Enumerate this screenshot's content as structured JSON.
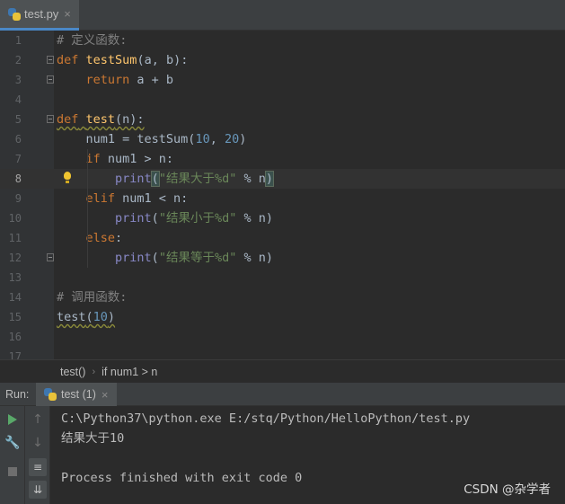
{
  "editor_tab": {
    "filename": "test.py",
    "close": "×"
  },
  "lines": [
    {
      "n": "1"
    },
    {
      "n": "2"
    },
    {
      "n": "3"
    },
    {
      "n": "4"
    },
    {
      "n": "5"
    },
    {
      "n": "6"
    },
    {
      "n": "7"
    },
    {
      "n": "8"
    },
    {
      "n": "9"
    },
    {
      "n": "10"
    },
    {
      "n": "11"
    },
    {
      "n": "12"
    },
    {
      "n": "13"
    },
    {
      "n": "14"
    },
    {
      "n": "15"
    },
    {
      "n": "16"
    },
    {
      "n": "17"
    }
  ],
  "code": {
    "l1_comment": "# 定义函数:",
    "l2_def": "def",
    "l2_name": "testSum",
    "l2_params": "(a, b):",
    "l3_return": "return",
    "l3_expr": " a + b",
    "l5_def": "def",
    "l5_name": "test",
    "l5_params": "(n):",
    "l6_a": "num1 = testSum(",
    "l6_n1": "10",
    "l6_comma": ", ",
    "l6_n2": "20",
    "l6_close": ")",
    "l7_if": "if",
    "l7_cond": " num1 > n:",
    "l8_print": "print",
    "l8_open": "(",
    "l8_str": "\"结果大于%d\"",
    "l8_rest": " % n",
    "l8_close": ")",
    "l9_elif": "elif",
    "l9_cond": " num1 < n:",
    "l10_print": "print",
    "l10_open": "(",
    "l10_str": "\"结果小于%d\"",
    "l10_rest": " % n)",
    "l11_else": "else",
    "l11_colon": ":",
    "l12_print": "print",
    "l12_open": "(",
    "l12_str": "\"结果等于%d\"",
    "l12_rest": " % n)",
    "l14_comment": "# 调用函数:",
    "l15_name": "test",
    "l15_open": "(",
    "l15_num": "10",
    "l15_close": ")"
  },
  "breadcrumb": {
    "item1": "test()",
    "sep": "›",
    "item2": "if num1 > n"
  },
  "run": {
    "label": "Run:",
    "tab": "test (1)",
    "close": "×"
  },
  "console": {
    "line1": "C:\\Python37\\python.exe E:/stq/Python/HelloPython/test.py",
    "line2": "结果大于10",
    "line3": "",
    "line4": "Process finished with exit code 0"
  },
  "watermark": "CSDN @杂学者",
  "colors": {
    "keyword": "#cc7832",
    "function": "#ffc66d",
    "number": "#6897bb",
    "string": "#6a8759",
    "comment": "#808080"
  }
}
